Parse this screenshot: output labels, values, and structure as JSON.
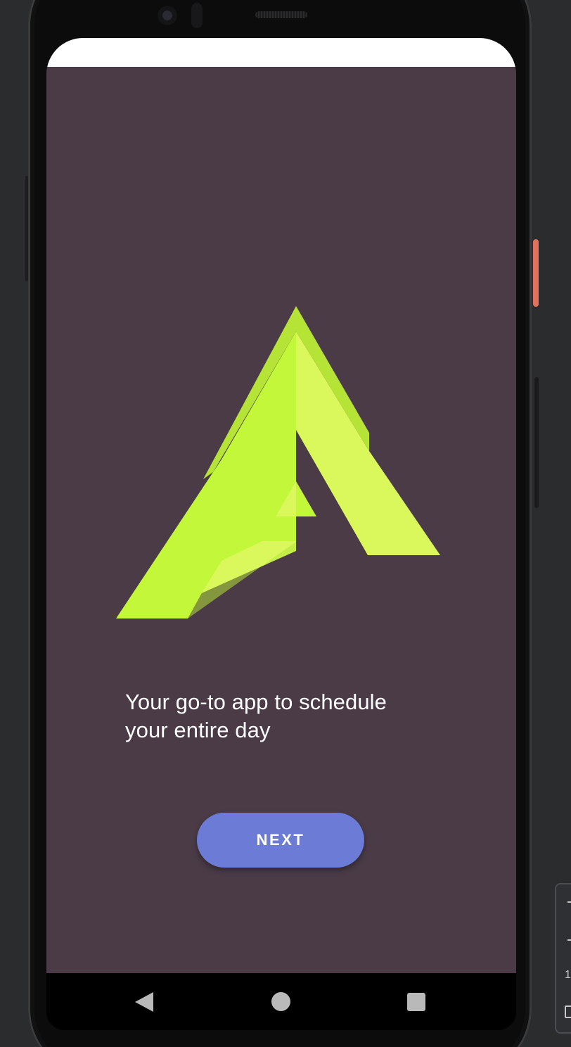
{
  "app": {
    "tagline": "Your go-to app to schedule your entire day",
    "next_button_label": "NEXT"
  },
  "icons": {
    "logo": "stylized-a-logo-icon",
    "nav_back": "back-triangle-icon",
    "nav_home": "home-circle-icon",
    "nav_recents": "recents-square-icon"
  },
  "side_toolbar": {
    "visible_glyph": "1"
  },
  "colors": {
    "screen_background": "#4a3b47",
    "status_bar": "#ffffff",
    "logo_primary": "#c3f73a",
    "logo_light": "#daf85c",
    "logo_shadow": "#b5e336",
    "button_background": "#6b7bd6",
    "nav_bar": "#000000",
    "power_button_accent": "#e2725b"
  }
}
